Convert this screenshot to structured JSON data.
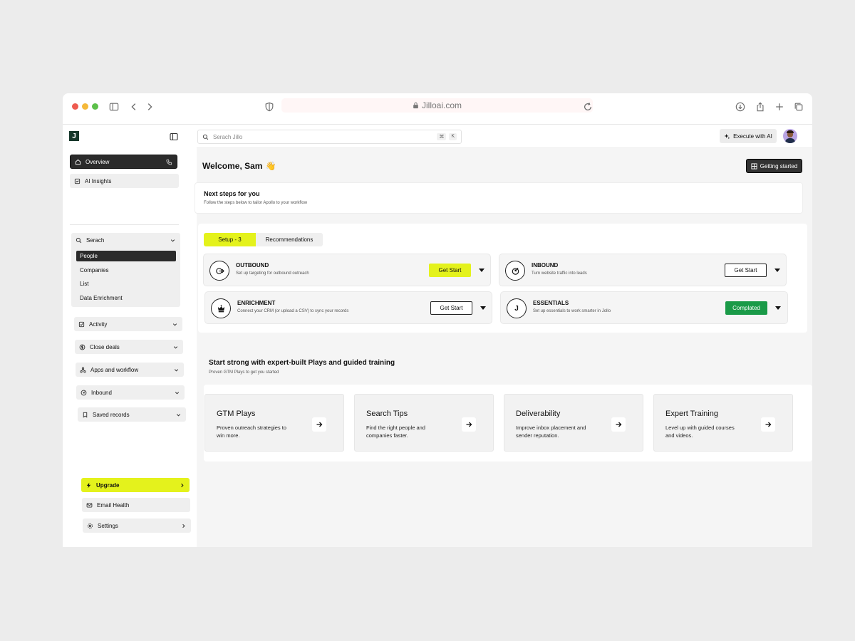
{
  "browser": {
    "url": "Jilloai.com"
  },
  "sidebar": {
    "logo": "J",
    "overview": "Overview",
    "ai_insights": "AI Insights",
    "search": {
      "label": "Serach",
      "items": [
        "People",
        "Companies",
        "List",
        "Data Enrichment"
      ]
    },
    "activity": "Activity",
    "close_deals": "Close deals",
    "apps_workflow": "Apps and workflow",
    "inbound": "Inbound",
    "saved_records": "Saved records",
    "upgrade": "Upgrade",
    "email_health": "Email Health",
    "settings": "Settings"
  },
  "topbar": {
    "search_placeholder": "Serach Jillo",
    "shortcut_cmd": "⌘",
    "shortcut_key": "K",
    "execute_ai": "Execute with AI"
  },
  "main": {
    "welcome": "Welcome, Sam",
    "welcome_emoji": "👋",
    "getting_started": "Getting started",
    "next_steps": {
      "title": "Next steps for you",
      "subtitle": "Follow the steps below to tailor Apollo to your workflow"
    },
    "tabs": {
      "setup": "Setup - 3",
      "recommendations": "Recommendations"
    },
    "steps": {
      "outbound": {
        "title": "OUTBOUND",
        "desc": "Set up targeting for outbound outreach",
        "button": "Get Start"
      },
      "inbound": {
        "title": "INBOUND",
        "desc": "Turn website traffic into leads",
        "button": "Get Start"
      },
      "enrichment": {
        "title": "ENRICHMENT",
        "desc": "Connect your CRM (or upload a CSV) to sync your records",
        "button": "Get Start"
      },
      "essentials": {
        "title": "ESSENTIALS",
        "icon_letter": "J",
        "desc": "Set up essentials to work smarter in Jollo",
        "button": "Complated"
      }
    },
    "plays": {
      "title": "Start strong with expert-built Plays and guided training",
      "subtitle": "Proven GTM Plays to get you started",
      "cards": [
        {
          "title": "GTM Plays",
          "desc": "Proven outreach strategies to win more."
        },
        {
          "title": "Search Tips",
          "desc": "Find the right people and companies faster."
        },
        {
          "title": "Deliverability",
          "desc": "Improve inbox placement and sender reputation."
        },
        {
          "title": "Expert Training",
          "desc": "Level up with guided courses and videos."
        }
      ]
    }
  },
  "colors": {
    "accent_yellow": "#e4f21c",
    "complete_green": "#1a9a48",
    "dark": "#2b2b2b"
  }
}
